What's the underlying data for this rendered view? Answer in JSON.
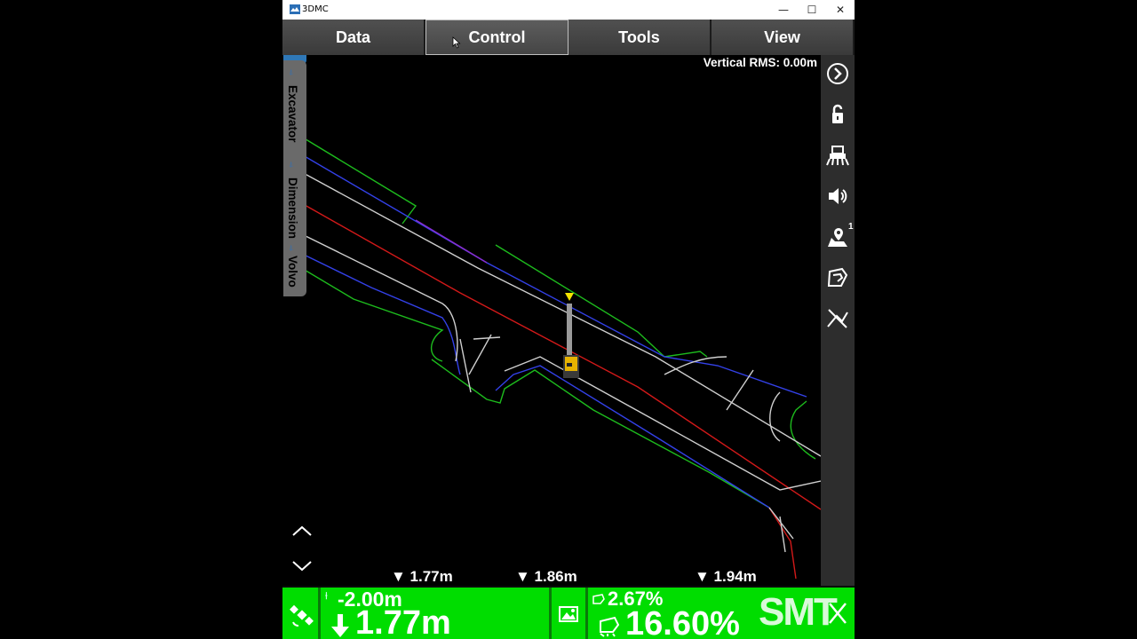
{
  "window": {
    "title": "3DMC",
    "minimize": "—",
    "maximize": "☐",
    "close": "✕"
  },
  "menu": [
    "Data",
    "Control",
    "Tools",
    "View"
  ],
  "status": {
    "vertical_rms": "Vertical RMS: 0.00m"
  },
  "side_tabs": [
    "Excavator",
    "Dimension",
    "Volvo"
  ],
  "right_toolbar": [
    "chevron-right-circle-icon",
    "unlock-icon",
    "machine-icon",
    "speaker-icon",
    "map-pin-icon",
    "bucket-icon",
    "no-design-icon"
  ],
  "map_pin_badge": "1",
  "dims": [
    "▼ 1.77m",
    "▼ 1.86m",
    "▼ 1.94m"
  ],
  "bottom": {
    "offset": "-2.00m",
    "cut_fill": "1.77m",
    "slope_small": "2.67%",
    "slope_large": "16.60%"
  },
  "watermark": "SMT"
}
